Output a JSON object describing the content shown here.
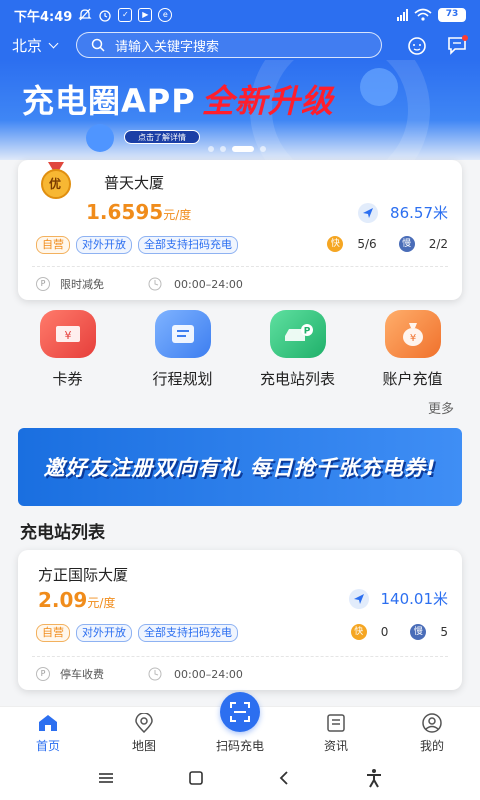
{
  "status_bar": {
    "time": "下午4:49",
    "battery": "73"
  },
  "header": {
    "city": "北京",
    "search_placeholder": "请输入关键字搜索"
  },
  "banner": {
    "title_main": "充电圈APP",
    "title_highlight": "全新升级",
    "detail_button": "点击了解详情",
    "slide_count": 4,
    "active_slide": 3
  },
  "featured_station": {
    "medal_label": "优",
    "name": "普天大厦",
    "price": "1.6595",
    "price_unit": "元/度",
    "distance": "86.57米",
    "tags": [
      "自营",
      "对外开放",
      "全部支持扫码充电"
    ],
    "fast_label": "快",
    "fast_count": "5/6",
    "slow_label": "慢",
    "slow_count": "2/2",
    "parking_note": "限时减免",
    "hours": "00:00–24:00"
  },
  "quick_actions": [
    {
      "label": "卡券",
      "icon": "coupon-icon",
      "color": "#f25a57"
    },
    {
      "label": "行程规划",
      "icon": "route-plan-icon",
      "color": "#4a8ff7"
    },
    {
      "label": "充电站列表",
      "icon": "station-list-icon",
      "color": "#2fc47a"
    },
    {
      "label": "账户充值",
      "icon": "wallet-icon",
      "color": "#f5893a"
    }
  ],
  "more_label": "更多",
  "promo": {
    "text": "邀好友注册双向有礼 每日抢千张充电券!"
  },
  "station_list": {
    "title": "充电站列表",
    "items": [
      {
        "name": "方正国际大厦",
        "price": "2.09",
        "price_unit": "元/度",
        "distance": "140.01米",
        "tags": [
          "自营",
          "对外开放",
          "全部支持扫码充电"
        ],
        "fast_label": "快",
        "fast_count": "0",
        "slow_label": "慢",
        "slow_count": "5",
        "parking_note": "停车收费",
        "hours": "00:00–24:00"
      }
    ]
  },
  "tabbar": [
    {
      "label": "首页",
      "icon": "home-icon",
      "active": true
    },
    {
      "label": "地图",
      "icon": "map-pin-icon",
      "active": false
    },
    {
      "label": "扫码充电",
      "icon": "scan-icon",
      "active": false
    },
    {
      "label": "资讯",
      "icon": "news-icon",
      "active": false
    },
    {
      "label": "我的",
      "icon": "profile-icon",
      "active": false
    }
  ],
  "colors": {
    "brand": "#2c6ff0",
    "price": "#f08c1b",
    "accent_red": "#ff1e2d"
  }
}
